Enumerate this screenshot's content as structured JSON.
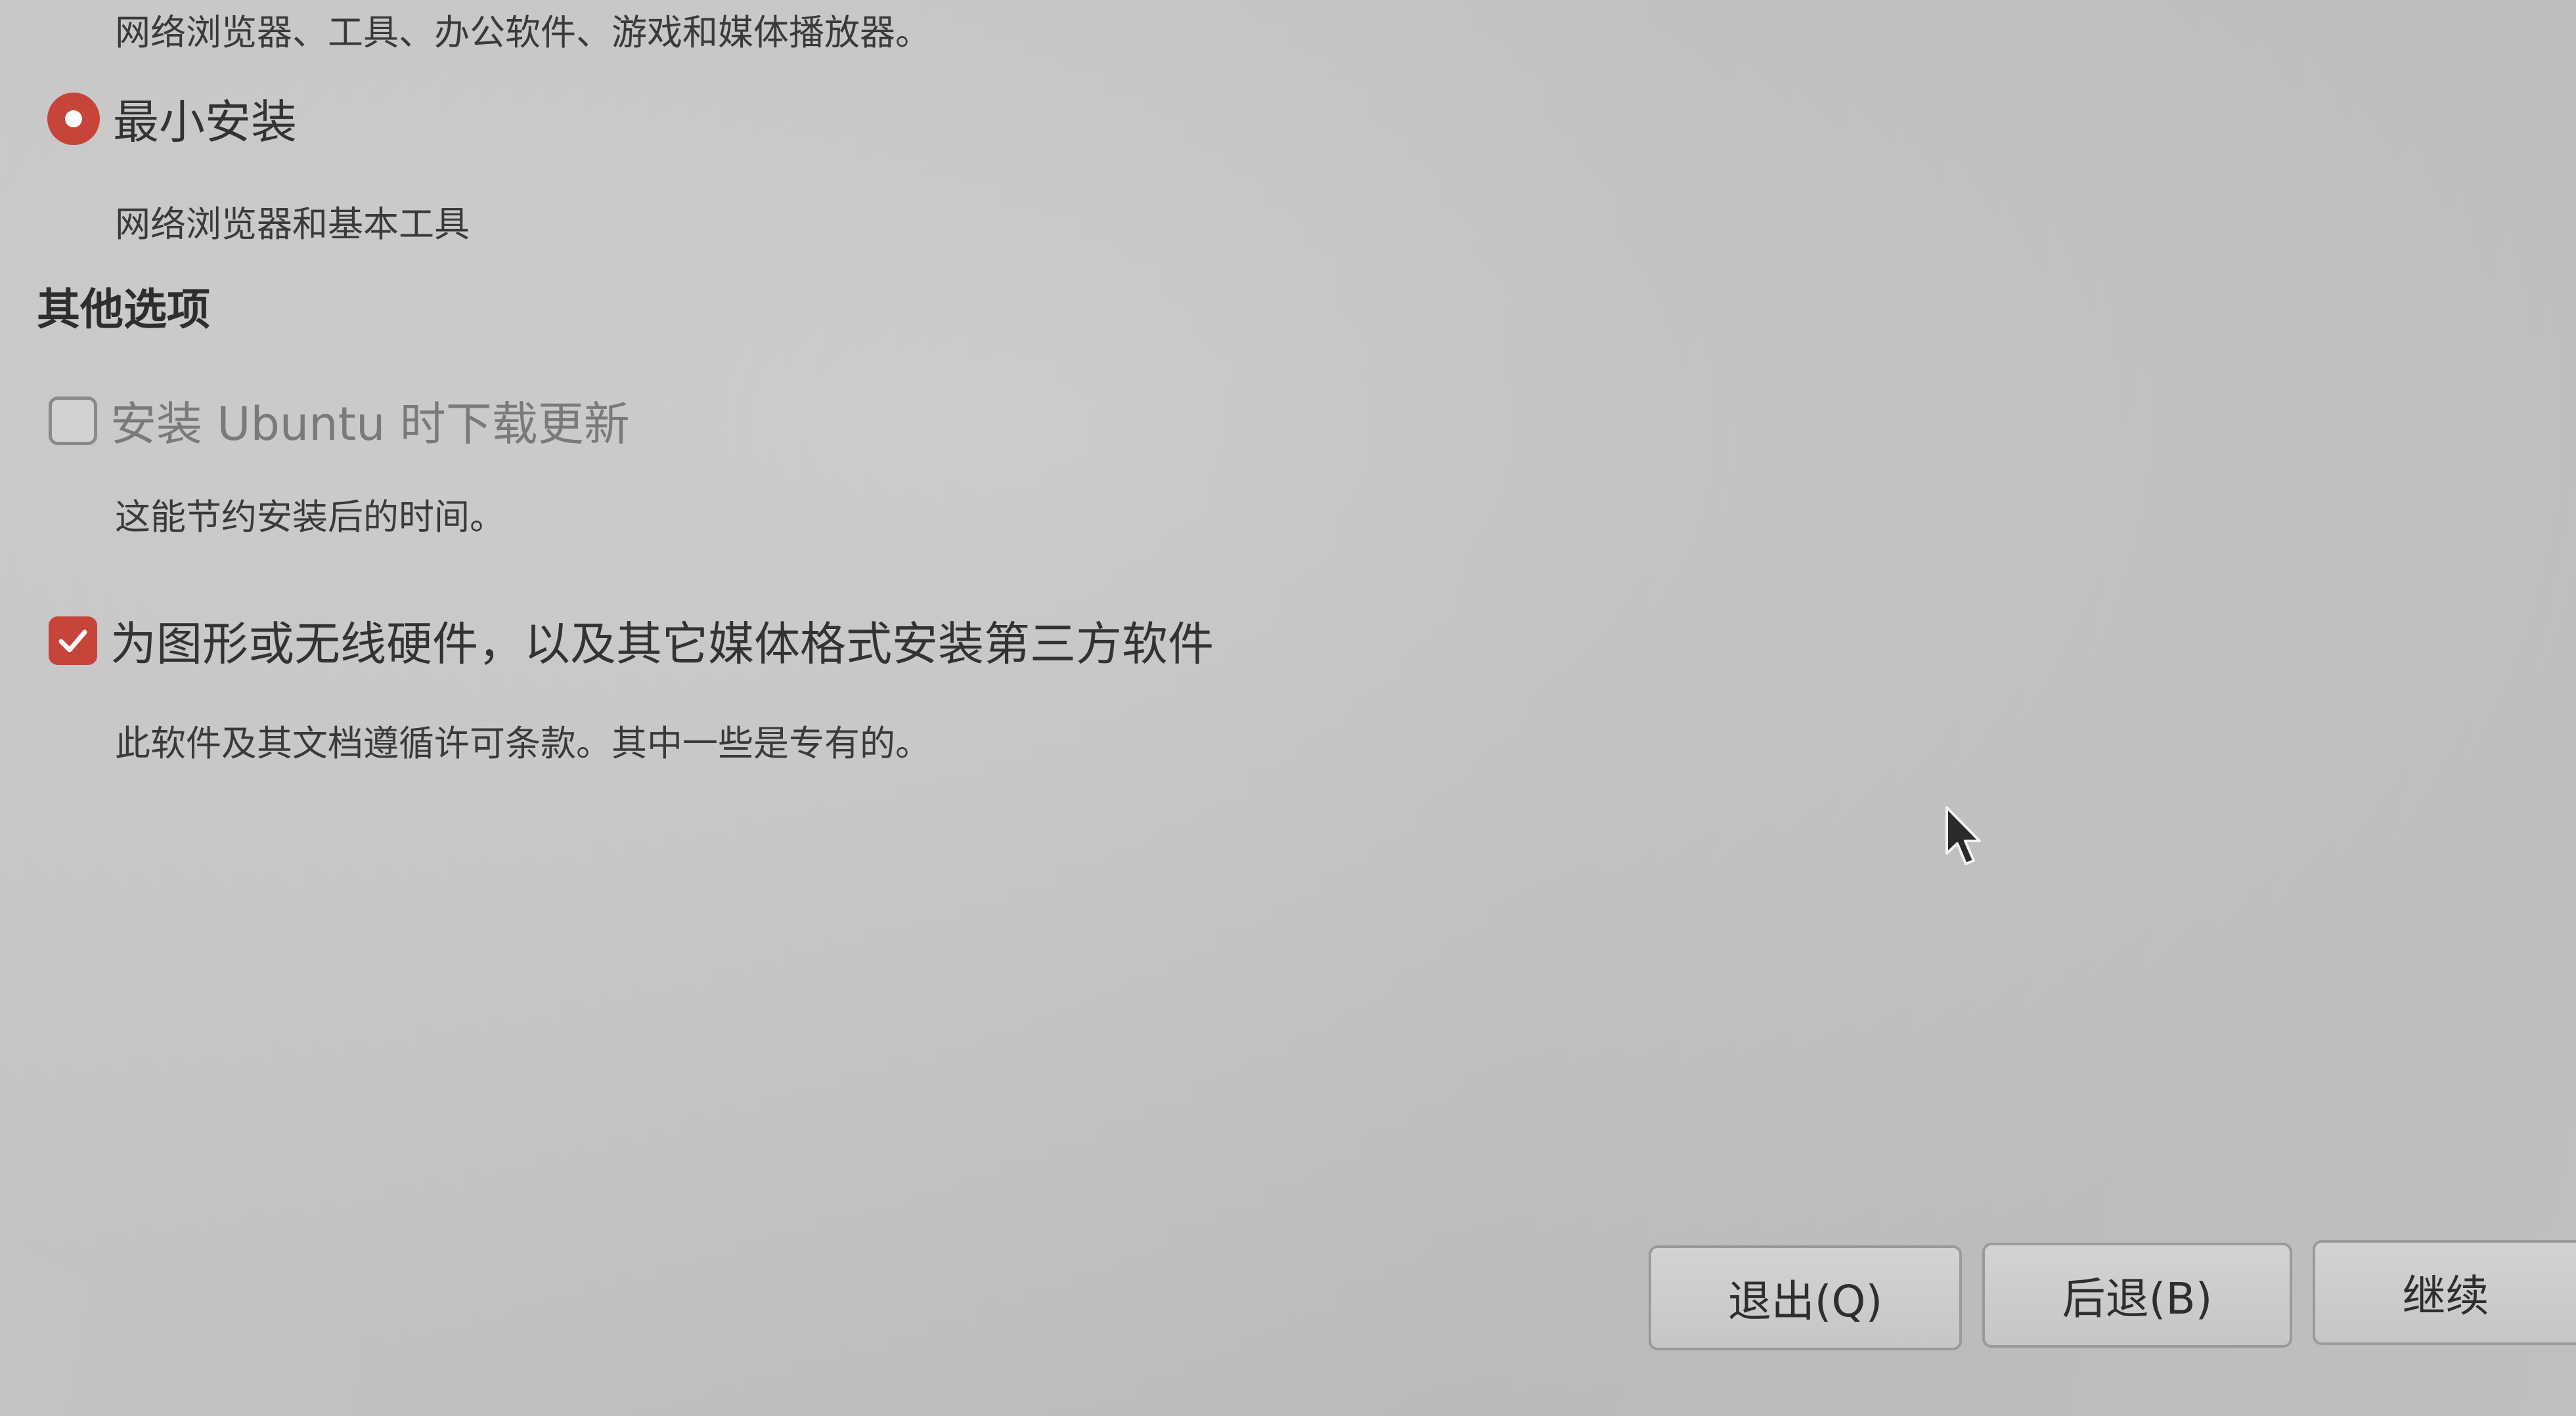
{
  "install_type": {
    "normal_desc": "网络浏览器、工具、办公软件、游戏和媒体播放器。",
    "minimal_label": "最小安装",
    "minimal_desc": "网络浏览器和基本工具",
    "minimal_selected": true
  },
  "other_options": {
    "title": "其他选项",
    "download_updates": {
      "label": "安装 Ubuntu 时下载更新",
      "desc": "这能节约安装后的时间。",
      "checked": false,
      "enabled": false
    },
    "third_party": {
      "label": "为图形或无线硬件，以及其它媒体格式安装第三方软件",
      "desc": "此软件及其文档遵循许可条款。其中一些是专有的。",
      "checked": true
    }
  },
  "buttons": {
    "quit": "退出(Q)",
    "back": "后退(B)",
    "continue": "继续"
  },
  "colors": {
    "accent": "#c7443a",
    "background": "#c9c9c9",
    "text": "#333333"
  },
  "icons": {
    "radio": "radio-selected-icon",
    "checkbox_checked": "checkmark-icon",
    "cursor": "mouse-pointer-icon"
  }
}
